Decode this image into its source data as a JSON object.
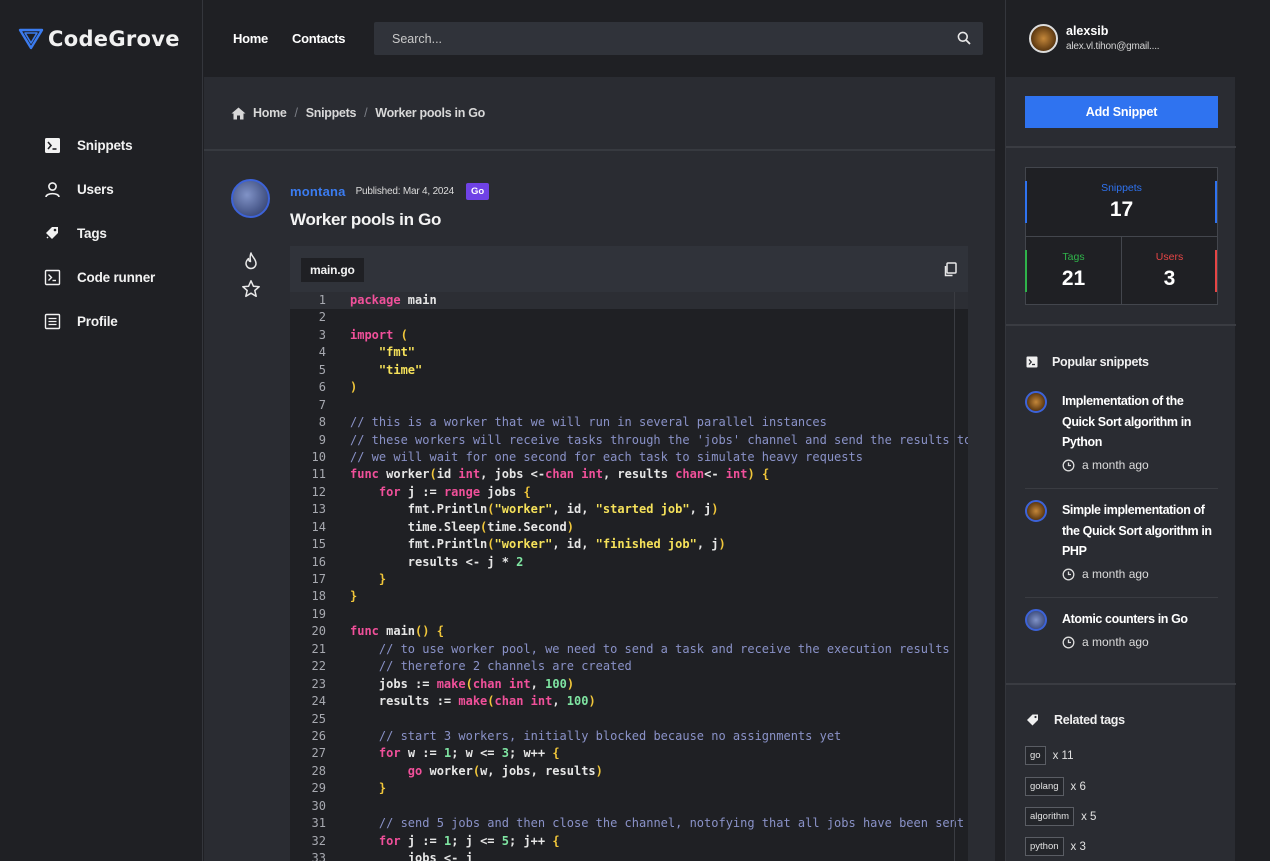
{
  "app": {
    "brand": "CodeGrove",
    "accent": "#2f73f0"
  },
  "sidebar": {
    "items": [
      {
        "label": "Snippets",
        "icon": "terminal-icon"
      },
      {
        "label": "Users",
        "icon": "user-icon"
      },
      {
        "label": "Tags",
        "icon": "tags-icon"
      },
      {
        "label": "Code runner",
        "icon": "code-runner-icon"
      },
      {
        "label": "Profile",
        "icon": "profile-icon"
      }
    ]
  },
  "header": {
    "links": [
      "Home",
      "Contacts"
    ],
    "search_placeholder": "Search..."
  },
  "breadcrumb": [
    "Home",
    "Snippets",
    "Worker pools in Go"
  ],
  "snippet": {
    "author": "montana",
    "published": "Published: Mar 4, 2024",
    "language": "Go",
    "title": "Worker pools in Go",
    "file": "main.go"
  },
  "code_lines": [
    "package main",
    "",
    "import (",
    "    \"fmt\"",
    "    \"time\"",
    ")",
    "",
    "// this is a worker that we will run in several parallel instances",
    "// these workers will receive tasks through the 'jobs' channel and send the results to",
    "// we will wait for one second for each task to simulate heavy requests",
    "func worker(id int, jobs <-chan int, results chan<- int) {",
    "    for j := range jobs {",
    "        fmt.Println(\"worker\", id, \"started job\", j)",
    "        time.Sleep(time.Second)",
    "        fmt.Println(\"worker\", id, \"finished job\", j)",
    "        results <- j * 2",
    "    }",
    "}",
    "",
    "func main() {",
    "    // to use worker pool, we need to send a task and receive the execution results",
    "    // therefore 2 channels are created",
    "    jobs := make(chan int, 100)",
    "    results := make(chan int, 100)",
    "",
    "    // start 3 workers, initially blocked because no assignments yet",
    "    for w := 1; w <= 3; w++ {",
    "        go worker(w, jobs, results)",
    "    }",
    "",
    "    // send 5 jobs and then close the channel, notofying that all jobs have been sent",
    "    for j := 1; j <= 5; j++ {",
    "        jobs <- j"
  ],
  "user": {
    "name": "alexsib",
    "email": "alex.vl.tihon@gmail...."
  },
  "add_snippet_label": "Add Snippet",
  "stats": {
    "snippets": {
      "label": "Snippets",
      "value": "17",
      "color": "#2f73f0"
    },
    "tags": {
      "label": "Tags",
      "value": "21",
      "color": "#2fb34a"
    },
    "users": {
      "label": "Users",
      "value": "3",
      "color": "#e64545"
    }
  },
  "popular": {
    "title": "Popular snippets",
    "items": [
      {
        "title": "Implementation of the Quick Sort algorithm in Python",
        "date": "a month ago"
      },
      {
        "title": "Simple implementation of the Quick Sort algorithm in PHP",
        "date": "a month ago"
      },
      {
        "title": "Atomic counters in Go",
        "date": "a month ago"
      }
    ]
  },
  "related_tags": {
    "title": "Related tags",
    "items": [
      {
        "tag": "go",
        "count": "x 11"
      },
      {
        "tag": "golang",
        "count": "x 6"
      },
      {
        "tag": "algorithm",
        "count": "x 5"
      },
      {
        "tag": "python",
        "count": "x 3"
      }
    ]
  }
}
